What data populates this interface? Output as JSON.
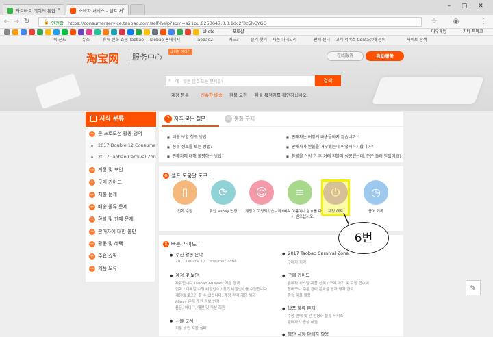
{
  "browser": {
    "tabs": [
      {
        "label": "타오바오 데이터 통합",
        "active": false
      },
      {
        "label": "소비자 서비스 - 셀프 서",
        "active": true
      }
    ],
    "secure_label": "안전함",
    "url": "https://consumerservice.taobao.com/self-help?spm=a21pu.8253647.0.0.1dc2f3c5hGYGO",
    "bookmarks": [
      "뉴스",
      "휴대 전화 쇼핑 Taobao",
      "Taobao 홈페이지",
      "Taobao2",
      "카드3",
      "즐겨 찾기",
      "제품 카테고리",
      "판매 센터",
      "고객 서비스 Contact에 문의",
      "사이트 탐색",
      "photo",
      "포토샵",
      "다우게임",
      "다우게임"
    ],
    "bookmark_right": "기타 북마크",
    "colors": {
      "accent": "#ff5000",
      "highlight": "#f7f300"
    }
  },
  "site_nav": [
    "북 진도",
    "뉴스",
    "휴대 전화 쇼핑 Taobao",
    "Taobao 홈페이지",
    "Taobao2",
    "카드3",
    "즐겨 찾기",
    "제품 카테고리",
    "판매 센터",
    "고객 서비스 Contact에 문의",
    "사이트 탐색"
  ],
  "header": {
    "logo": "淘宝网",
    "subtitle": "服务中心",
    "badge": "소비자 에디션",
    "online_service": "在线服务",
    "self_service": "自助服务",
    "search_placeholder": "예 - 잊은 암호 또는 문제를?",
    "search_button": "검색",
    "hot_links": [
      "계정 등록",
      "신속한 배송",
      "환불 요청",
      "환불 목적지를 확인하십시오."
    ]
  },
  "sidebar": {
    "title": "지식 분류",
    "items": [
      {
        "label": "큰 프로모션 활동 영역",
        "type": "open"
      },
      {
        "label": "2017 Double 12 Consumer Zone",
        "type": "sub"
      },
      {
        "label": "2017 Taobao Carnival Zone",
        "type": "sub"
      },
      {
        "label": "계정 및 보안",
        "type": "plus"
      },
      {
        "label": "구매 가이드",
        "type": "plus"
      },
      {
        "label": "지불 문제",
        "type": "plus"
      },
      {
        "label": "배송 물류 문제",
        "type": "plus"
      },
      {
        "label": "환불 및 판매 문제",
        "type": "plus"
      },
      {
        "label": "판매자에 대한 불만",
        "type": "plus"
      },
      {
        "label": "활동 및 혜택",
        "type": "plus"
      },
      {
        "label": "주요 쇼핑",
        "type": "plus"
      },
      {
        "label": "제품 오류",
        "type": "plus"
      }
    ]
  },
  "faq": {
    "tabs": [
      "자주 묻는 질문",
      "통화 문제"
    ],
    "questions": [
      "배송 보험 청구 방법",
      "판매자는 어떻게 배송을하지 않습니까?",
      "종류 정보를 보는 방법?",
      "판매자가 환불을 거부했는데 어떻게하지합니까?",
      "판매자에 대해 불평하는 방법?",
      "환불을 신청 한 후 거래 환불이 성공했는데, 돈은 돌려 받았어요?"
    ]
  },
  "tools": {
    "title": "셀프 도움말 도구 :",
    "items": [
      {
        "label": "전화 수정",
        "glyph": "▯",
        "color": "#f5b87c"
      },
      {
        "label": "묶인 Alipay 변경",
        "glyph": "⟳",
        "color": "#8fd3d6"
      },
      {
        "label": "계정이 고정되었습니까?",
        "glyph": "☺",
        "color": "#f59aa8"
      },
      {
        "label": "비워 이름이나 암호를 다시 받으십시오.",
        "glyph": "≡",
        "color": "#a8d88c"
      },
      {
        "label": "계정 해지",
        "glyph": "⏻",
        "color": "#c5a5ea"
      },
      {
        "label": "용어 기록",
        "glyph": "◷",
        "color": "#9ec9ef"
      }
    ]
  },
  "quick_guide": {
    "title": "빠른 가이드 :",
    "sections": [
      {
        "heading": "주진 활동 분야",
        "lines": [
          "2017 Double 12 Consumer Zone"
        ]
      },
      {
        "heading": "2017 Taobao Carnival Zone",
        "lines": [
          "구매자 지역"
        ]
      },
      {
        "heading": "계정 및 보안",
        "lines": [
          "자유합니다 Taobao  Ali Want  계정 등록",
          "전화 / 이메일 수정  비밀번호 / 찾기 비밀번호를 수정합니다.",
          "계정에 로그인 할 수 없습니다.  계정 판매  계정 해지",
          "Alipay 문제  개인 정보 변경",
          "용문, 아이디, 대판 및 파산 회원"
        ]
      },
      {
        "heading": "구매 가이드",
        "lines": [
          "판매자 시스템  제품 선택 / 구매  아기 및 요청 접수에",
          "장바구니  주문 관리  은숙을 평가  평가 관리",
          "환승 꿈을 활용"
        ]
      },
      {
        "heading": "지불 문제",
        "lines": [
          "지불 방법  지불 실패"
        ]
      },
      {
        "heading": "납품 물류 문제",
        "lines": [
          "수송  판매 및 인 반응하  물류 서비스",
          "판매자의 증상 해결"
        ]
      },
      {
        "heading": "불만 사항 판매자 활용",
        "lines": []
      }
    ]
  },
  "annotation": {
    "label": "6번"
  },
  "icons": {
    "edit": "edit-icon"
  }
}
